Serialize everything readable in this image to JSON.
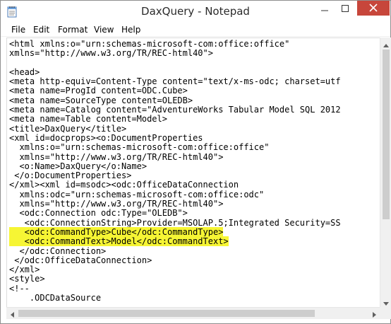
{
  "window": {
    "title": "DaxQuery - Notepad"
  },
  "menu": {
    "items": [
      {
        "label": "File"
      },
      {
        "label": "Edit"
      },
      {
        "label": "Format"
      },
      {
        "label": "View"
      },
      {
        "label": "Help"
      }
    ]
  },
  "editor": {
    "lines": [
      {
        "text": "<html xmlns:o=\"urn:schemas-microsoft-com:office:office\"",
        "highlighted": false
      },
      {
        "text": "xmlns=\"http://www.w3.org/TR/REC-html40\">",
        "highlighted": false
      },
      {
        "text": "",
        "highlighted": false
      },
      {
        "text": "<head>",
        "highlighted": false
      },
      {
        "text": "<meta http-equiv=Content-Type content=\"text/x-ms-odc; charset=utf",
        "highlighted": false
      },
      {
        "text": "<meta name=ProgId content=ODC.Cube>",
        "highlighted": false
      },
      {
        "text": "<meta name=SourceType content=OLEDB>",
        "highlighted": false
      },
      {
        "text": "<meta name=Catalog content=\"AdventureWorks Tabular Model SQL 2012",
        "highlighted": false
      },
      {
        "text": "<meta name=Table content=Model>",
        "highlighted": false
      },
      {
        "text": "<title>DaxQuery</title>",
        "highlighted": false
      },
      {
        "text": "<xml id=docprops><o:DocumentProperties",
        "highlighted": false
      },
      {
        "text": "  xmlns:o=\"urn:schemas-microsoft-com:office:office\"",
        "highlighted": false
      },
      {
        "text": "  xmlns=\"http://www.w3.org/TR/REC-html40\">",
        "highlighted": false
      },
      {
        "text": "  <o:Name>DaxQuery</o:Name>",
        "highlighted": false
      },
      {
        "text": " </o:DocumentProperties>",
        "highlighted": false
      },
      {
        "text": "</xml><xml id=msodc><odc:OfficeDataConnection",
        "highlighted": false
      },
      {
        "text": "  xmlns:odc=\"urn:schemas-microsoft-com:office:odc\"",
        "highlighted": false
      },
      {
        "text": "  xmlns=\"http://www.w3.org/TR/REC-html40\">",
        "highlighted": false
      },
      {
        "text": "  <odc:Connection odc:Type=\"OLEDB\">",
        "highlighted": false
      },
      {
        "text": "   <odc:ConnectionString>Provider=MSOLAP.5;Integrated Security=SS",
        "highlighted": false
      },
      {
        "text": "   <odc:CommandType>Cube</odc:CommandType>",
        "highlighted": true
      },
      {
        "text": "   <odc:CommandText>Model</odc:CommandText>",
        "highlighted": true
      },
      {
        "text": "  </odc:Connection>",
        "highlighted": false
      },
      {
        "text": " </odc:OfficeDataConnection>",
        "highlighted": false
      },
      {
        "text": "</xml>",
        "highlighted": false
      },
      {
        "text": "<style>",
        "highlighted": false
      },
      {
        "text": "<!--",
        "highlighted": false
      },
      {
        "text": "    .ODCDataSource",
        "highlighted": false
      }
    ]
  },
  "colors": {
    "close_button": "#c7463b",
    "highlight": "#f6f534"
  },
  "icons": {
    "app": "notepad-icon",
    "minimize": "minimize-icon",
    "maximize": "maximize-icon",
    "close": "close-icon"
  }
}
